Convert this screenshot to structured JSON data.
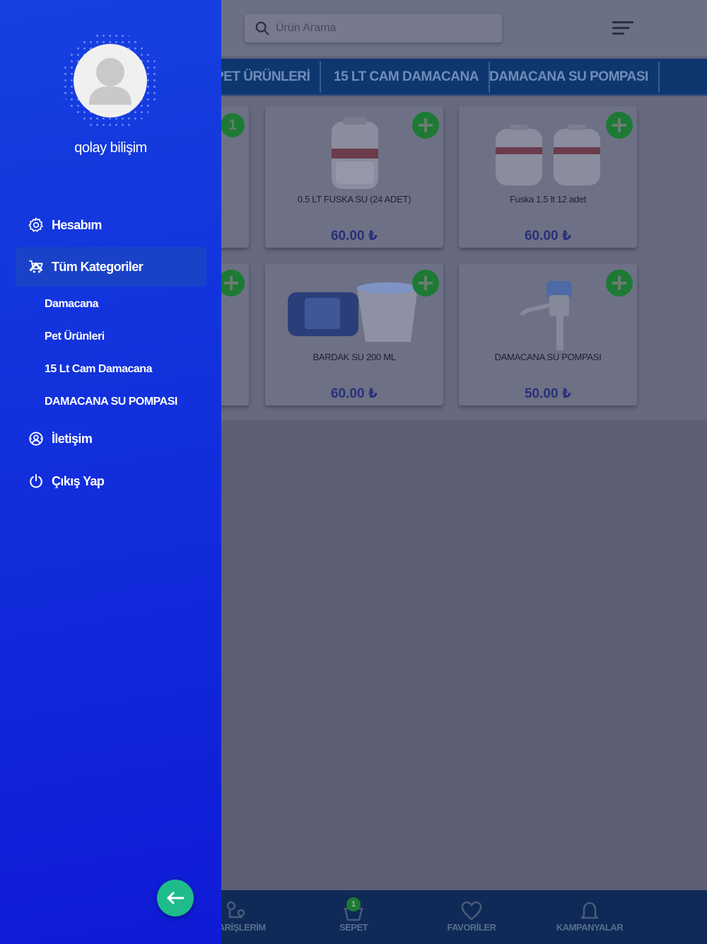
{
  "search": {
    "placeholder": "Ürün Arama"
  },
  "category_tabs": [
    "PET ÜRÜNLERİ",
    "15 LT CAM DAMACANA",
    "DAMACANA SU POMPASI"
  ],
  "products": [
    {
      "name": "0.5 LT FUSKA SU (24 ADET)",
      "price": "60.00 ₺"
    },
    {
      "name": "Fuska 1.5 lt 12 adet",
      "price": "60.00 ₺"
    },
    {
      "name": "BARDAK SU 200 ML",
      "price": "60.00 ₺"
    },
    {
      "name": "DAMACANA SU POMPASI",
      "price": "50.00 ₺"
    }
  ],
  "partial_card": {
    "quantity_badge": "1"
  },
  "bottom_nav": {
    "orders": "SİPARİŞLERİM",
    "cart": "SEPET",
    "cart_count": "1",
    "favorites": "FAVORİLER",
    "campaigns": "KAMPANYALAR"
  },
  "drawer": {
    "username": "qolay bilişim",
    "account": "Hesabım",
    "all_categories": "Tüm Kategoriler",
    "sub_categories": [
      "Damacana",
      "Pet Ürünleri",
      "15 Lt Cam Damacana",
      "DAMACANA SU POMPASI"
    ],
    "contact": "İletişim",
    "logout": "Çıkış Yap"
  },
  "colors": {
    "drawer_gradient_start": "#1640e0",
    "drawer_gradient_end": "#0f1bd6",
    "back_fab": "#1ebc8a",
    "overlay": "#5c5f74"
  },
  "icons": {
    "account": "gear-icon",
    "categories": "cart-icon",
    "contact": "support-icon",
    "logout": "power-icon",
    "back": "arrow-left-icon"
  }
}
